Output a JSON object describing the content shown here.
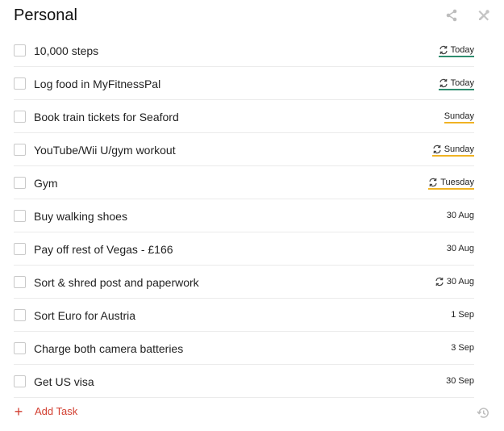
{
  "header": {
    "title": "Personal",
    "share_icon": "share-icon",
    "tools_icon": "tools-icon"
  },
  "tasks": [
    {
      "text": "10,000 steps",
      "due": "Today",
      "repeat": true,
      "highlight": "today"
    },
    {
      "text": "Log food in MyFitnessPal",
      "due": "Today",
      "repeat": true,
      "highlight": "today"
    },
    {
      "text": "Book train tickets for Seaford",
      "due": "Sunday",
      "repeat": false,
      "highlight": "soon"
    },
    {
      "text": "YouTube/Wii U/gym workout",
      "due": "Sunday",
      "repeat": true,
      "highlight": "soon"
    },
    {
      "text": "Gym",
      "due": "Tuesday",
      "repeat": true,
      "highlight": "soon"
    },
    {
      "text": "Buy walking shoes",
      "due": "30 Aug",
      "repeat": false,
      "highlight": "none"
    },
    {
      "text": "Pay off rest of Vegas - £166",
      "due": "30 Aug",
      "repeat": false,
      "highlight": "none"
    },
    {
      "text": "Sort & shred post and paperwork",
      "due": "30 Aug",
      "repeat": true,
      "highlight": "none"
    },
    {
      "text": "Sort Euro for Austria",
      "due": "1 Sep",
      "repeat": false,
      "highlight": "none"
    },
    {
      "text": "Charge both camera batteries",
      "due": "3 Sep",
      "repeat": false,
      "highlight": "none"
    },
    {
      "text": "Get US visa",
      "due": "30 Sep",
      "repeat": false,
      "highlight": "none"
    }
  ],
  "footer": {
    "add_task_label": "Add Task",
    "history_icon": "history-icon"
  },
  "colors": {
    "accent_red": "#d23f31",
    "today_underline": "#2e8c6e",
    "soon_underline": "#f0b323"
  }
}
